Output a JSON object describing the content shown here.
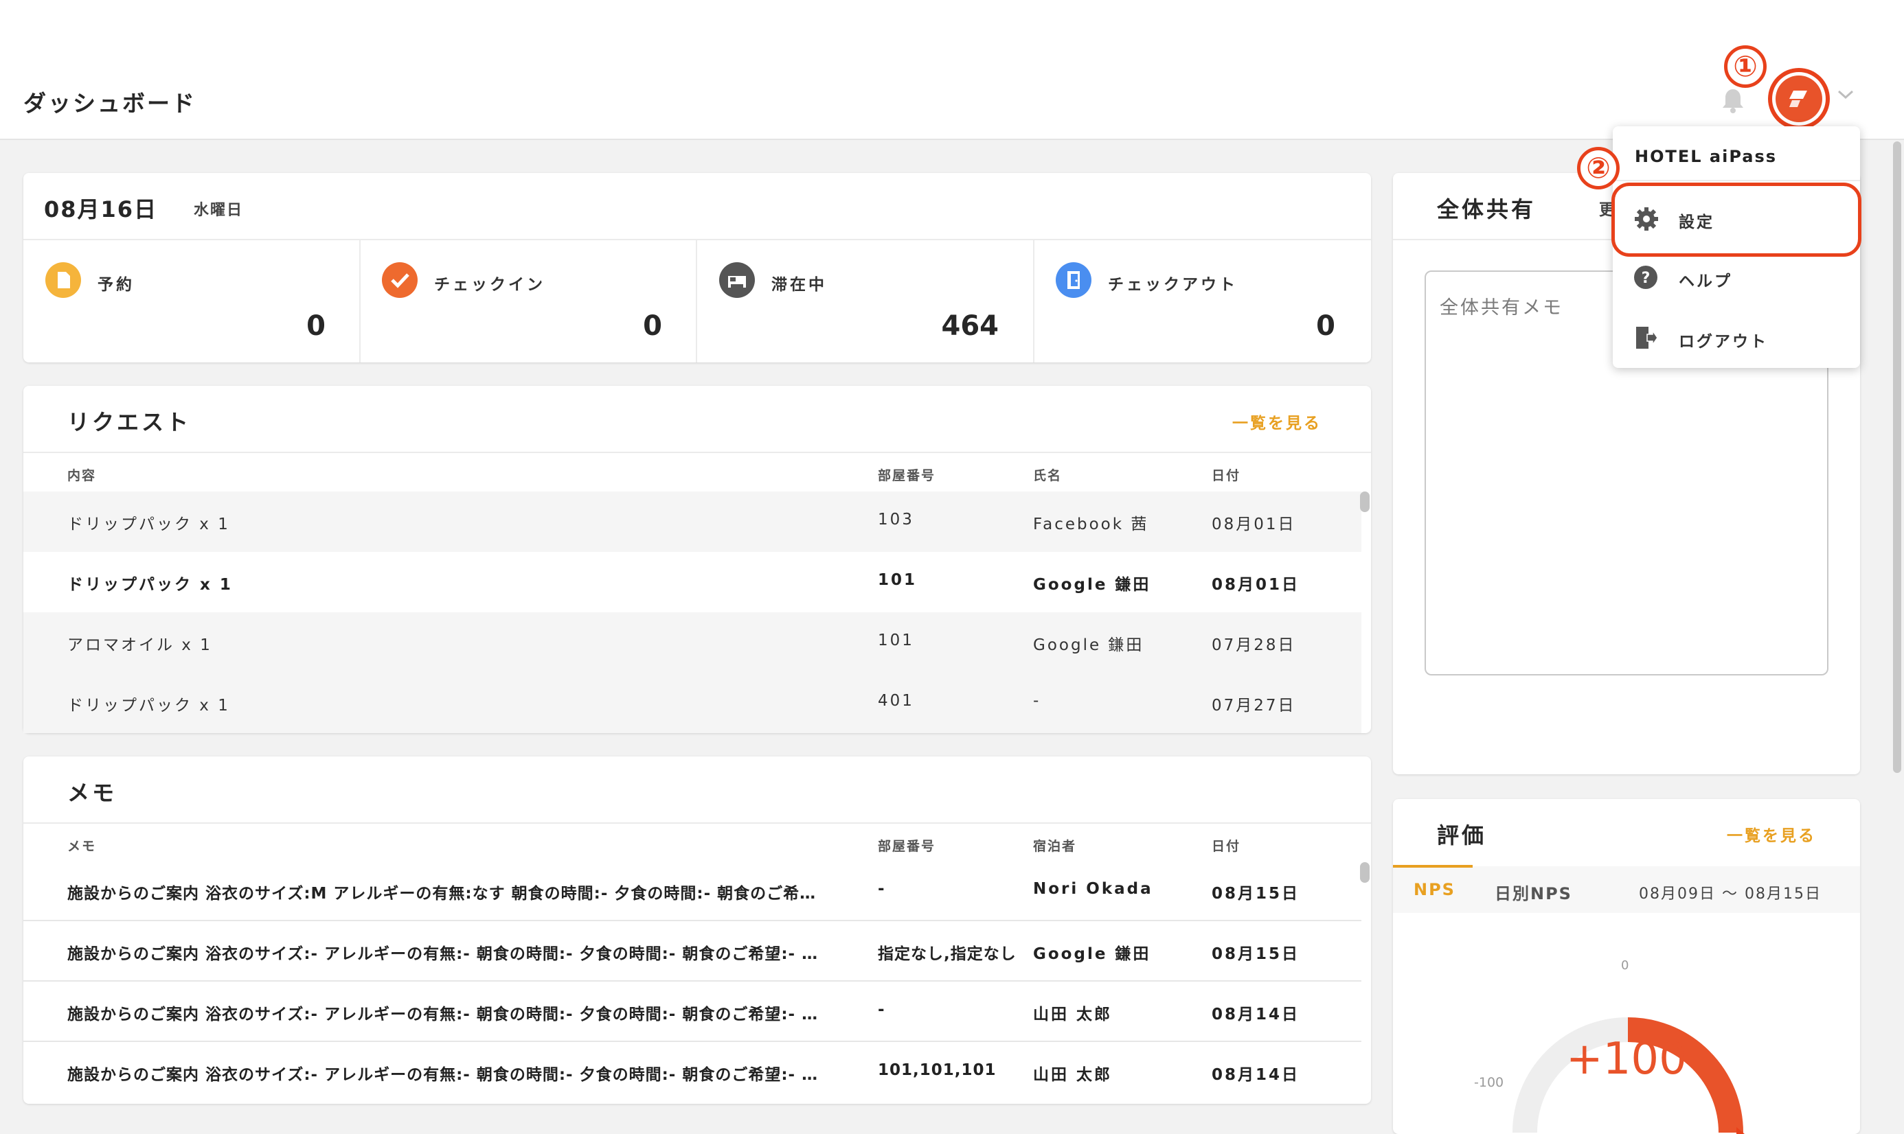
{
  "header": {
    "title": "ダッシュボード",
    "annotation_1": "①",
    "annotation_2": "②"
  },
  "user_menu": {
    "hotel_name": "HOTEL aiPass",
    "items": [
      {
        "label": "設定",
        "icon": "gear-icon"
      },
      {
        "label": "ヘルプ",
        "icon": "help-icon"
      },
      {
        "label": "ログアウト",
        "icon": "logout-icon"
      }
    ]
  },
  "summary": {
    "date": "08月16日",
    "weekday": "水曜日",
    "stats": [
      {
        "label": "予約",
        "value": "0",
        "icon": "document-icon",
        "color": "#f5b43b"
      },
      {
        "label": "チェックイン",
        "value": "0",
        "icon": "check-icon",
        "color": "#ee6a2e"
      },
      {
        "label": "滞在中",
        "value": "464",
        "icon": "bed-icon",
        "color": "#555555"
      },
      {
        "label": "チェックアウト",
        "value": "0",
        "icon": "door-icon",
        "color": "#4a8ef0"
      }
    ]
  },
  "requests": {
    "title": "リクエスト",
    "view_all": "一覧を見る",
    "columns": [
      "内容",
      "部屋番号",
      "氏名",
      "日付"
    ],
    "rows": [
      {
        "content": "ドリップパック x 1",
        "room": "103",
        "name": "Facebook 茜",
        "date": "08月01日",
        "bold": false
      },
      {
        "content": "ドリップパック x 1",
        "room": "101",
        "name": "Google 鎌田",
        "date": "08月01日",
        "bold": true
      },
      {
        "content": "アロマオイル x 1",
        "room": "101",
        "name": "Google 鎌田",
        "date": "07月28日",
        "bold": false
      },
      {
        "content": "ドリップパック x 1",
        "room": "401",
        "name": "-",
        "date": "07月27日",
        "bold": false
      }
    ]
  },
  "memos": {
    "title": "メモ",
    "columns": [
      "メモ",
      "部屋番号",
      "宿泊者",
      "日付"
    ],
    "rows": [
      {
        "memo": "施設からのご案内 浴衣のサイズ:M アレルギーの有無:なす 朝食の時間:- 夕食の時間:- 朝食のご希…",
        "room": "-",
        "guest": "Nori Okada",
        "date": "08月15日"
      },
      {
        "memo": "施設からのご案内 浴衣のサイズ:- アレルギーの有無:- 朝食の時間:- 夕食の時間:- 朝食のご希望:- …",
        "room": "指定なし,指定なし",
        "guest": "Google 鎌田",
        "date": "08月15日"
      },
      {
        "memo": "施設からのご案内 浴衣のサイズ:- アレルギーの有無:- 朝食の時間:- 夕食の時間:- 朝食のご希望:- …",
        "room": "-",
        "guest": "山田 太郎",
        "date": "08月14日"
      },
      {
        "memo": "施設からのご案内 浴衣のサイズ:- アレルギーの有無:- 朝食の時間:- 夕食の時間:- 朝食のご希望:- …",
        "room": "101,101,101",
        "guest": "山田 太郎",
        "date": "08月14日"
      }
    ]
  },
  "share": {
    "title": "全体共有",
    "update_partial": "更",
    "placeholder": "全体共有メモ"
  },
  "reviews": {
    "title": "評価",
    "view_all": "一覧を見る",
    "tabs": [
      "NPS",
      "日別NPS"
    ],
    "range": "08月09日 〜 08月15日",
    "gauge": {
      "value": "+100",
      "min_label": "-100",
      "mid_label": "0",
      "level": 100
    }
  },
  "colors": {
    "accent": "#e8a021",
    "brand": "#e8532a",
    "callout": "#e8411b"
  }
}
